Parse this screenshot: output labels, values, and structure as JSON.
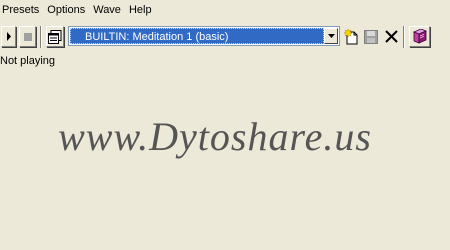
{
  "menu": {
    "items": [
      "Presets",
      "Options",
      "Wave",
      "Help"
    ]
  },
  "toolbar": {
    "preset_selected": "BUILTIN: Meditation 1 (basic)"
  },
  "status": {
    "text": "Not playing"
  },
  "watermark": {
    "text": "www.Dytoshare.us"
  },
  "icons": {
    "play": "play-icon",
    "stop": "stop-icon",
    "properties": "properties-icon",
    "dropdown": "chevron-down-icon",
    "new": "new-file-icon",
    "save": "save-icon",
    "delete": "close-icon",
    "book": "book-icon"
  },
  "colors": {
    "background": "#ECE9D8",
    "selection": "#316AC5",
    "watermark": "#555555"
  }
}
